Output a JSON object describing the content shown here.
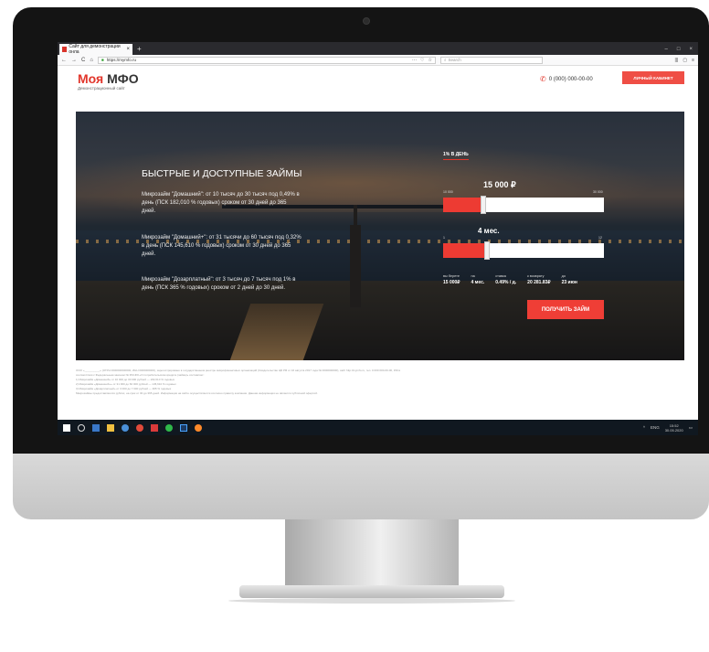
{
  "browser": {
    "tab_title": "Сайт для демонстрации онла",
    "tab_close": "×",
    "new_tab": "+",
    "window_controls": [
      "–",
      "□",
      "×"
    ],
    "nav_icons": [
      "←",
      "→",
      "C",
      "⌂"
    ],
    "url": "https://mymfo.ru",
    "url_tools": [
      "···",
      "♡",
      "☆"
    ],
    "search_placeholder": "Search",
    "right_tools": [
      "|||",
      "▢",
      "≡"
    ]
  },
  "site": {
    "logo_primary": "Моя",
    "logo_secondary": "МФО",
    "logo_subtitle": "Демонстрационный сайт",
    "phone": "0 (000) 000-00-00",
    "cabinet_button": "Личный кабинет"
  },
  "hero": {
    "title": "БЫСТРЫЕ И ДОСТУПНЫЕ ЗАЙМЫ",
    "descriptions": [
      "Микрозайм \"Домашний\": от 10 тысяч до 30 тысяч под 0,49% в день (ПСК 182,010 % годовых) сроком от 30 дней до 365 дней.",
      "Микрозайм \"Домашний+\": от 31 тысячи до 60 тысяч под 0,32% в день (ПСК 145,610 % годовых) сроком от 30 дней до 365 дней.",
      "Микрозайм \"Дозарплатный\": от 3 тысяч до 7 тысяч под 1% в день (ПСК 365 % годовых) сроком от 2 дней до 30 дней."
    ]
  },
  "calculator": {
    "rate_label": "1% В ДЕНЬ",
    "amount": {
      "value_label": "15 000 ₽",
      "min_label": "10 000",
      "max_label": "30 000",
      "fraction": 0.25
    },
    "term": {
      "value_label": "4 мес.",
      "min_label": "1",
      "max_label": "12",
      "fraction": 0.27
    },
    "summary": [
      {
        "label": "вы берете",
        "value": "15 000₽"
      },
      {
        "label": "на",
        "value": "4 мес."
      },
      {
        "label": "ставка",
        "value": "0.49% / д."
      },
      {
        "label": "к возврату",
        "value": "20 281.83₽"
      },
      {
        "label": "до",
        "value": "23 июн"
      }
    ],
    "submit_button": "Получить займ"
  },
  "footnote": [
    "ООО «__________» (ОГРН 0000000000000, ИНН 0000000000), зарегистрировано в государственном реестре микрофинансовых организаций (Свидетельство ЦБ РФ от 16 августа 2017 года № 0000000000), сайт http://mymfo.ru, тел. 0 000 000-00-00, 150 в",
    "соответствии с Федеральным законом № 353-ФЗ «О потребительском кредите (займе)» составляет:",
    "1) Микрозайм «Домашний» от 10 000 до 30 000 рублей — 182,010 % годовых",
    "2) Микрозайм «Домашний+» от 31 000 до 60 000 рублей — 145,610 % годовых",
    "3) Микрозайм «Дозарплатный» от 3 000 до 7 000 рублей — 365 % годовых",
    "Микрозаймы предоставляются рублях, на срок от 30 до 365 дней. Информация на сайте осуществляется согласно правилу компании. Данная информация не является публичной офертой."
  ],
  "taskbar": {
    "apps": [
      "windows",
      "search",
      "cortana",
      "file-explorer",
      "chrome",
      "opera",
      "app-red",
      "whatsapp",
      "photoshop",
      "firefox"
    ],
    "tray_lang": "ENG",
    "tray_time": "15:52",
    "tray_date": "30.05.2020"
  },
  "colors": {
    "accent": "#ef3e36",
    "slider_track": "#ffffff",
    "taskbar": "#101820",
    "browser_tabbar": "#2a2a2e"
  }
}
